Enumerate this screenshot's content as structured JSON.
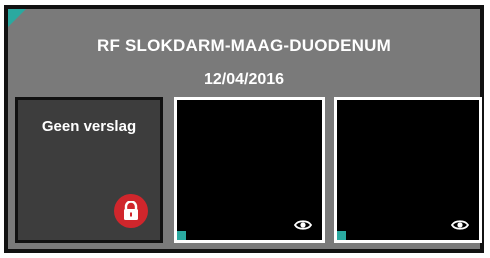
{
  "card": {
    "title": "RF SLOKDARM-MAAG-DUODENUM",
    "date": "12/04/2016"
  },
  "report": {
    "label": "Geen verslag"
  },
  "icons": {
    "lock": "lock-icon",
    "view": "eye-icon",
    "corner": "teal-corner"
  },
  "colors": {
    "card_bg": "#7a7a7a",
    "accent": "#2aa9a0",
    "lock_bg": "#d0262c"
  }
}
